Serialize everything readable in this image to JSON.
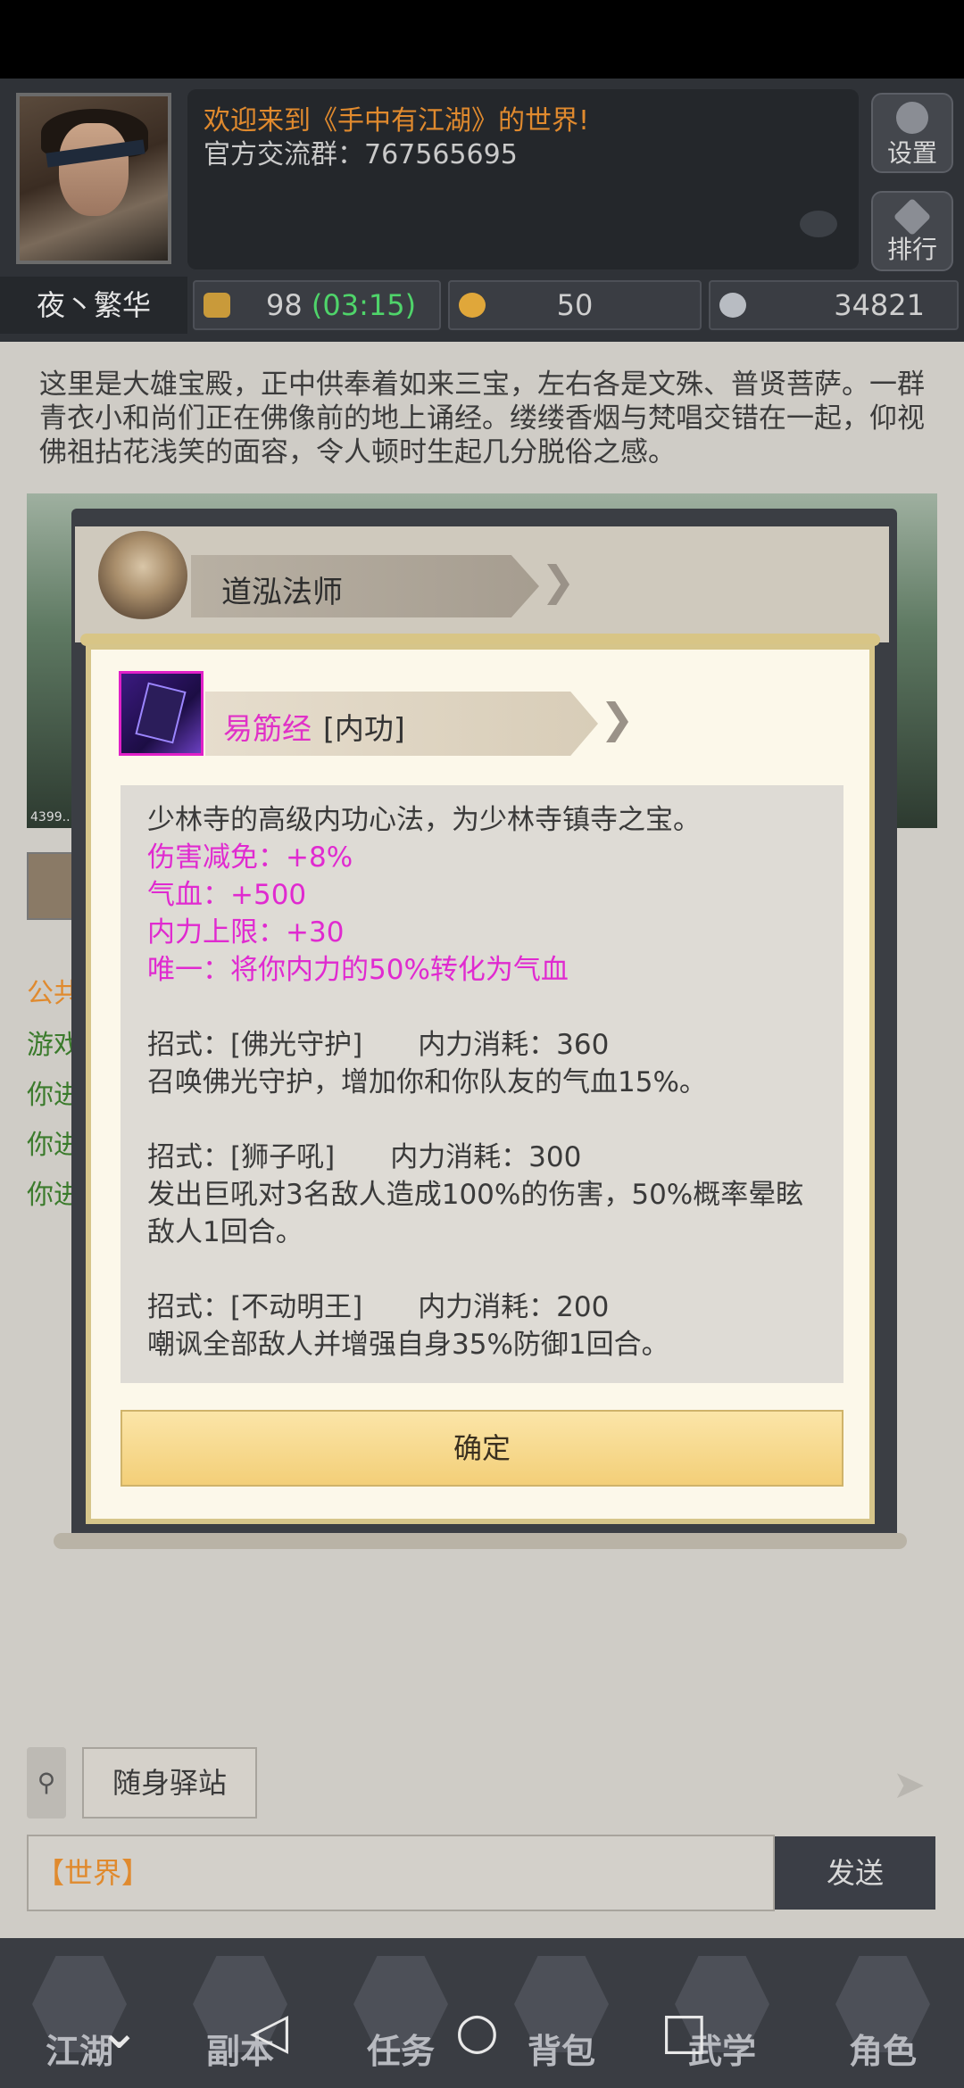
{
  "header": {
    "welcome": "欢迎来到《手中有江湖》的世界!",
    "group": "官方交流群：767565695",
    "player_name": "夜丶繁华",
    "settings_label": "设置",
    "rank_label": "排行",
    "energy": "98",
    "energy_timer": "(03:15)",
    "gold": "50",
    "silver": "34821"
  },
  "scene": {
    "description": "这里是大雄宝殿，正中供奉着如来三宝，左右各是文殊、普贤菩萨。一群青衣小和尚们正在佛像前的地上诵经。缕缕香烟与梵唱交错在一起，仰视佛祖拈花浅笑的面容，令人顿时生起几分脱俗之感。",
    "watermark": "4399...",
    "log": [
      "公共",
      "游戏",
      "你进",
      "你进",
      "你进"
    ]
  },
  "dialog": {
    "npc_name": "道泓法师",
    "skill_name": "易筋经",
    "skill_type": "[内功]",
    "intro": "少林寺的高级内功心法，为少林寺镇寺之宝。",
    "stats": [
      "伤害减免：+8%",
      "气血：+500",
      "内力上限：+30",
      "唯一：将你内力的50%转化为气血"
    ],
    "moves": [
      {
        "header": "招式：[佛光守护]　　内力消耗：360",
        "desc": "召唤佛光守护，增加你和你队友的气血15%。"
      },
      {
        "header": "招式：[狮子吼]　　内力消耗：300",
        "desc": "发出巨吼对3名敌人造成100%的伤害，50%概率晕眩敌人1回合。"
      },
      {
        "header": "招式：[不动明王]　　内力消耗：200",
        "desc": "嘲讽全部敌人并增强自身35%防御1回合。"
      }
    ],
    "confirm": "确定"
  },
  "chat": {
    "station": "随身驿站",
    "channel": "【世界】",
    "send": "发送"
  },
  "nav": [
    "江湖",
    "副本",
    "任务",
    "背包",
    "武学",
    "角色"
  ],
  "colors": {
    "accent_pink": "#e02ad0",
    "accent_orange": "#e08a2e",
    "timer_green": "#4fd46a"
  }
}
